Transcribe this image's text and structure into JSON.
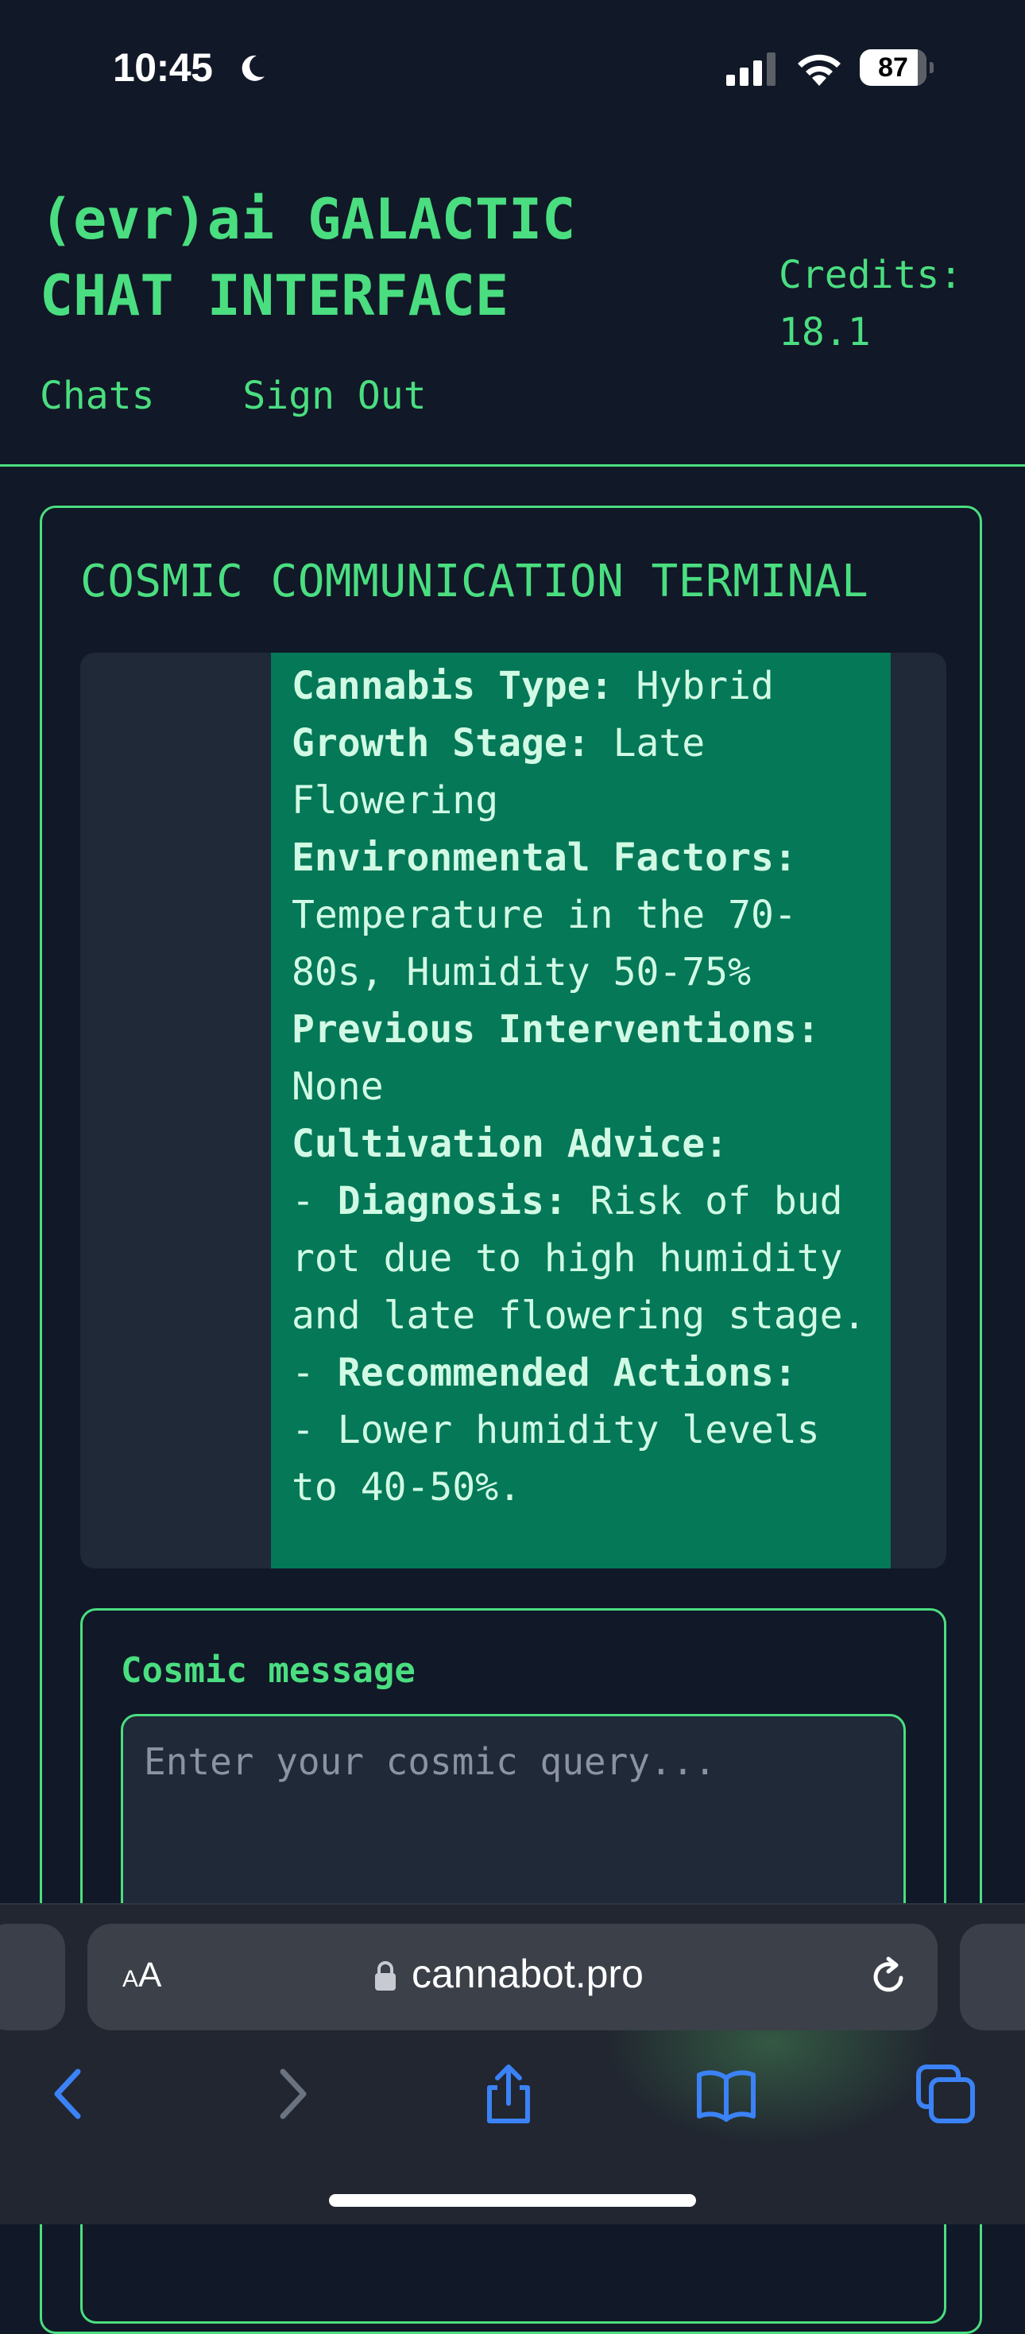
{
  "status_bar": {
    "time": "10:45",
    "battery_level": "87",
    "battery_fraction": 0.87
  },
  "header": {
    "title": "(evr)ai GALACTIC CHAT INTERFACE",
    "credits": "Credits: 18.1",
    "nav": {
      "chats": "Chats",
      "sign_out": "Sign Out"
    }
  },
  "terminal": {
    "title": "COSMIC COMMUNICATION TERMINAL",
    "message": [
      {
        "label": "Cannabis Type:",
        "text": " Hybrid"
      },
      {
        "label": "Growth Stage:",
        "text": " Late Flowering"
      },
      {
        "label": "Environmental Factors:",
        "text": " Temperature in the 70-80s, Humidity 50-75%"
      },
      {
        "label": "Previous Interventions:",
        "text": " None"
      },
      {
        "label": "Cultivation Advice:",
        "text": ""
      },
      {
        "prefix": "- ",
        "label": "Diagnosis:",
        "text": " Risk of bud rot due to high humidity and late flowering stage."
      },
      {
        "prefix": "- ",
        "label": "Recommended Actions:",
        "text": ""
      },
      {
        "text": "- Lower humidity levels to 40-50%."
      }
    ],
    "form": {
      "label": "Cosmic message",
      "placeholder": "Enter your cosmic query..."
    }
  },
  "browser": {
    "text_size_small": "A",
    "text_size_large": "A",
    "url": "cannabot.pro",
    "icons": [
      "back-icon",
      "forward-icon",
      "share-icon",
      "bookmarks-icon",
      "tabs-icon",
      "lock-icon",
      "reload-icon"
    ]
  },
  "colors": {
    "background": "#111827",
    "accent": "#4ade80",
    "bubble": "#047857",
    "panel": "#1f2937",
    "ios_blue": "#3b82f6"
  }
}
